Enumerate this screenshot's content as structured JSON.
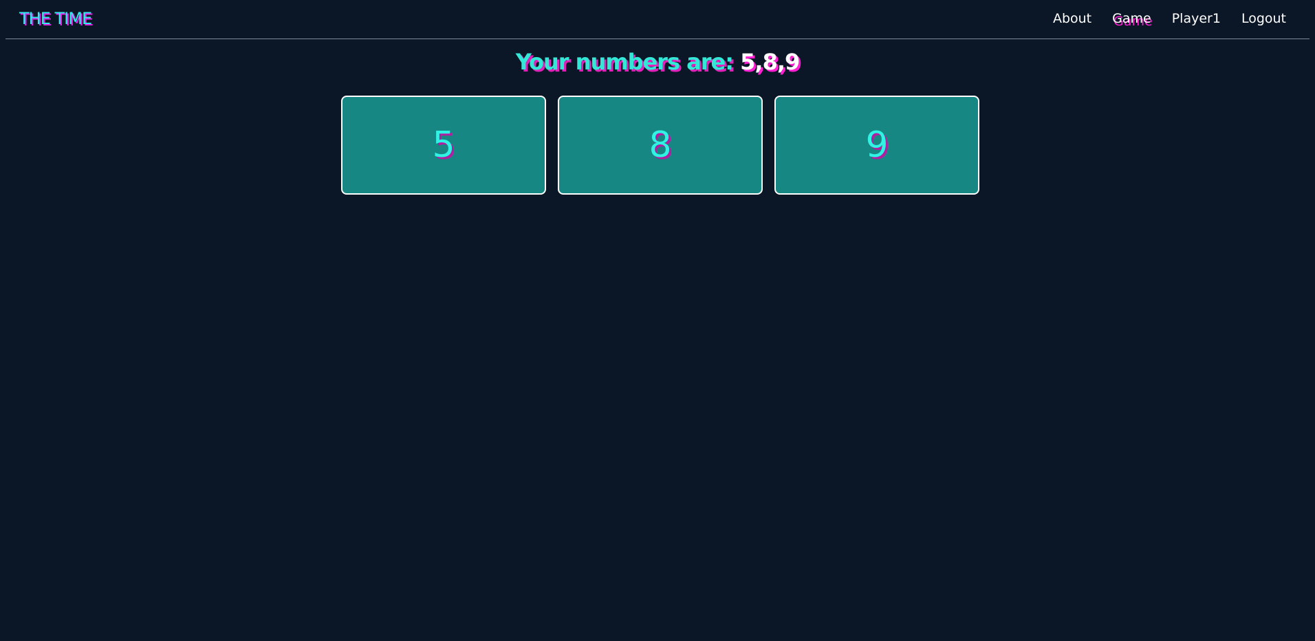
{
  "navbar": {
    "brand": "THE TIME",
    "links": [
      "About",
      "Game",
      "Player1",
      "Logout"
    ],
    "active_link": "Game"
  },
  "main": {
    "heading_label": "Your numbers are:",
    "heading_numbers": "5,8,9",
    "cards": [
      "5",
      "8",
      "9"
    ]
  },
  "colors": {
    "background": "#0b1727",
    "card_fill": "#178784",
    "accent_cyan": "#34e8d8",
    "accent_magenta": "#e020e0"
  }
}
